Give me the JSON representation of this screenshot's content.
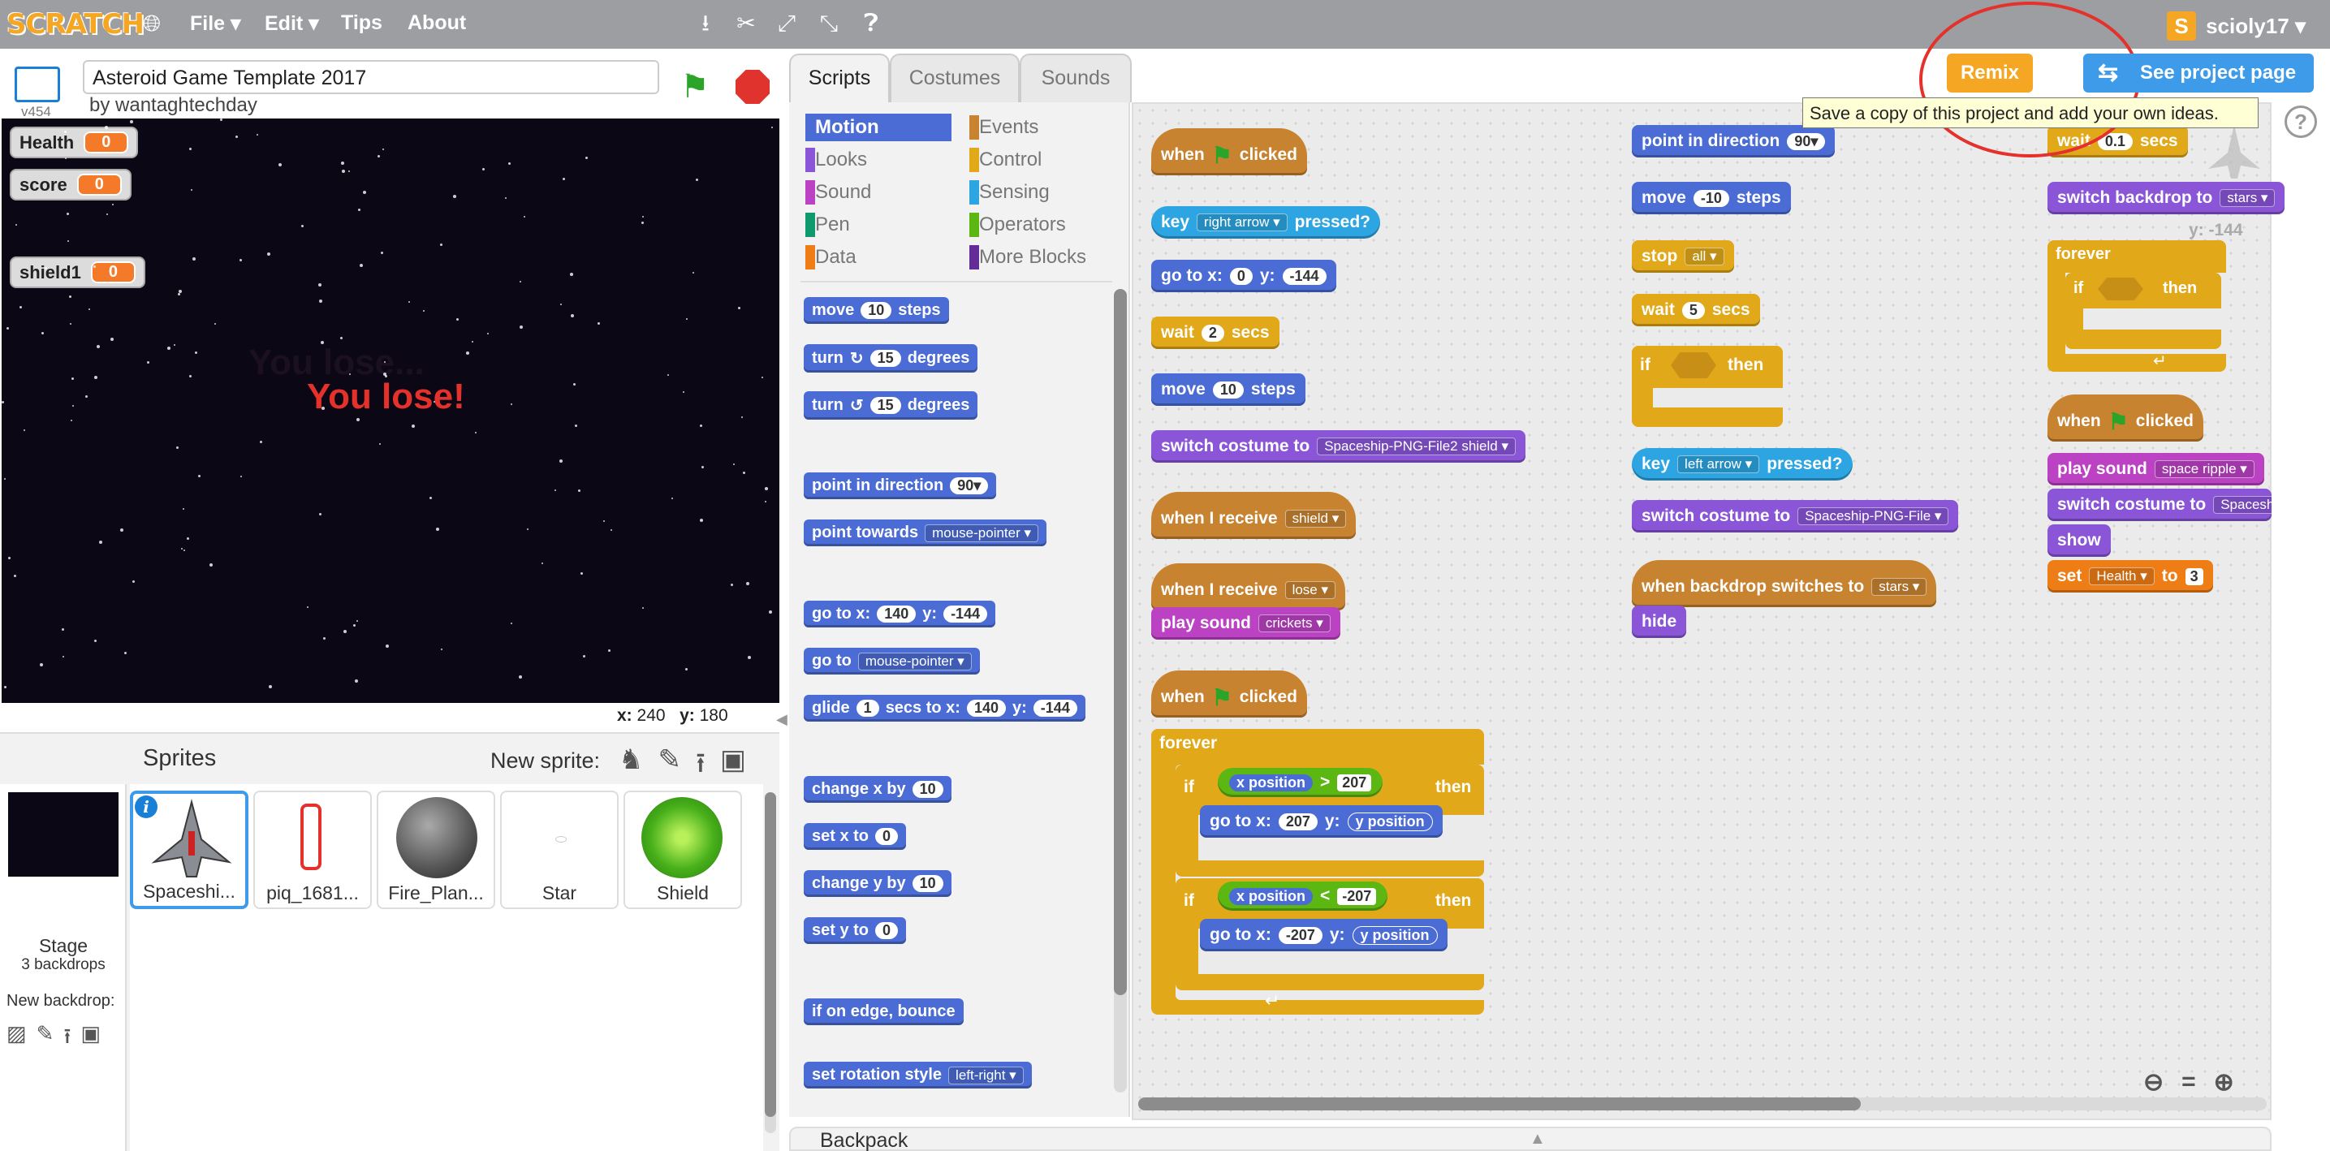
{
  "menu": {
    "logo": "SCRATCH",
    "file": "File ▾",
    "edit": "Edit ▾",
    "tips": "Tips",
    "about": "About"
  },
  "user": {
    "name": "scioly17 ▾",
    "avatar_letter": "S"
  },
  "project": {
    "title": "Asteroid Game Template 2017",
    "author": "by wantaghtechday",
    "version": "v454"
  },
  "stage": {
    "monitors": [
      {
        "label": "Health",
        "value": "0"
      },
      {
        "label": "score",
        "value": "0"
      },
      {
        "label": "shield1",
        "value": "0"
      }
    ],
    "lose_text": "You lose!",
    "lose_ghost": "You lose..."
  },
  "coords": {
    "x_label": "x:",
    "x": "240",
    "y_label": "y:",
    "y": "180"
  },
  "sprites": {
    "header": "Sprites",
    "new_sprite": "New sprite:",
    "stage_label": "Stage",
    "stage_sub": "3 backdrops",
    "new_backdrop": "New backdrop:",
    "items": [
      {
        "name": "Spaceshi..."
      },
      {
        "name": "piq_1681..."
      },
      {
        "name": "Fire_Plan..."
      },
      {
        "name": "Star"
      },
      {
        "name": "Shield"
      }
    ]
  },
  "tabs": {
    "scripts": "Scripts",
    "costumes": "Costumes",
    "sounds": "Sounds"
  },
  "categories": {
    "motion": "Motion",
    "looks": "Looks",
    "sound": "Sound",
    "pen": "Pen",
    "data": "Data",
    "events": "Events",
    "control": "Control",
    "sensing": "Sensing",
    "operators": "Operators",
    "more": "More Blocks"
  },
  "palette": {
    "move": "move",
    "move_n": "10",
    "steps": "steps",
    "turn": "turn",
    "turn_n": "15",
    "degrees": "degrees",
    "point_dir": "point in direction",
    "point_dir_v": "90▾",
    "point_towards": "point towards",
    "mouse_pointer": "mouse-pointer ▾",
    "goto_xy": "go to x:",
    "x140": "140",
    "y_": "y:",
    "ym144": "-144",
    "goto": "go to",
    "glide": "glide",
    "glide_n": "1",
    "secs_to_x": "secs to x:",
    "change_x": "change x by",
    "ten": "10",
    "set_x": "set x to",
    "zero": "0",
    "change_y": "change y by",
    "set_y": "set y to",
    "bounce": "if on edge, bounce",
    "rot_style": "set rotation style",
    "left_right": "left-right ▾"
  },
  "scripts": {
    "when": "when",
    "clicked": "clicked",
    "key": "key",
    "right_arrow": "right arrow ▾",
    "pressed": "pressed?",
    "goto_x": "go to x:",
    "zero": "0",
    "y": "y:",
    "ym144": "-144",
    "wait": "wait",
    "two": "2",
    "secs": "secs",
    "move": "move",
    "ten": "10",
    "steps": "steps",
    "switch_costume": "switch costume to",
    "costume_shield": "Spaceship-PNG-File2 shield ▾",
    "when_receive": "when I receive",
    "shield": "shield ▾",
    "lose": "lose ▾",
    "play_sound": "play sound",
    "crickets": "crickets ▾",
    "forever": "forever",
    "if": "if",
    "then": "then",
    "x_position": "x position",
    "gt": ">",
    "n207": "207",
    "lt": "<",
    "nm207": "-207",
    "y_position": "y position",
    "point_dir": "point in direction",
    "dir90": "90▾",
    "move_m10": "-10",
    "stop": "stop",
    "all": "all ▾",
    "five": "5",
    "left_arrow": "left arrow ▾",
    "costume_png": "Spaceship-PNG-File ▾",
    "when_backdrop": "when backdrop switches to",
    "stars": "stars ▾",
    "hide": "hide",
    "wait01": "0.1",
    "switch_backdrop": "switch backdrop to",
    "stars2": "stars ▾",
    "ghost_y": "y: -144",
    "space_ripple": "space ripple ▾",
    "spacesh": "Spacesh",
    "show": "show",
    "set": "set",
    "health": "Health ▾",
    "to": "to",
    "three": "3"
  },
  "buttons": {
    "remix": "Remix",
    "see_project": "See project page"
  },
  "tooltip": "Save a copy of this project and add your own ideas.",
  "backpack": "Backpack",
  "colors": {
    "motion": "#4a6cd4",
    "events": "#c88330",
    "control": "#e1a91a",
    "looks": "#8a55d7",
    "sound": "#bb42c3",
    "sensing": "#2ca5e2",
    "operators": "#5cb712",
    "data": "#ee7d16",
    "pen": "#0e9a6c",
    "more": "#632d99",
    "remix": "#f5a623",
    "see_project": "#3d9be9"
  }
}
